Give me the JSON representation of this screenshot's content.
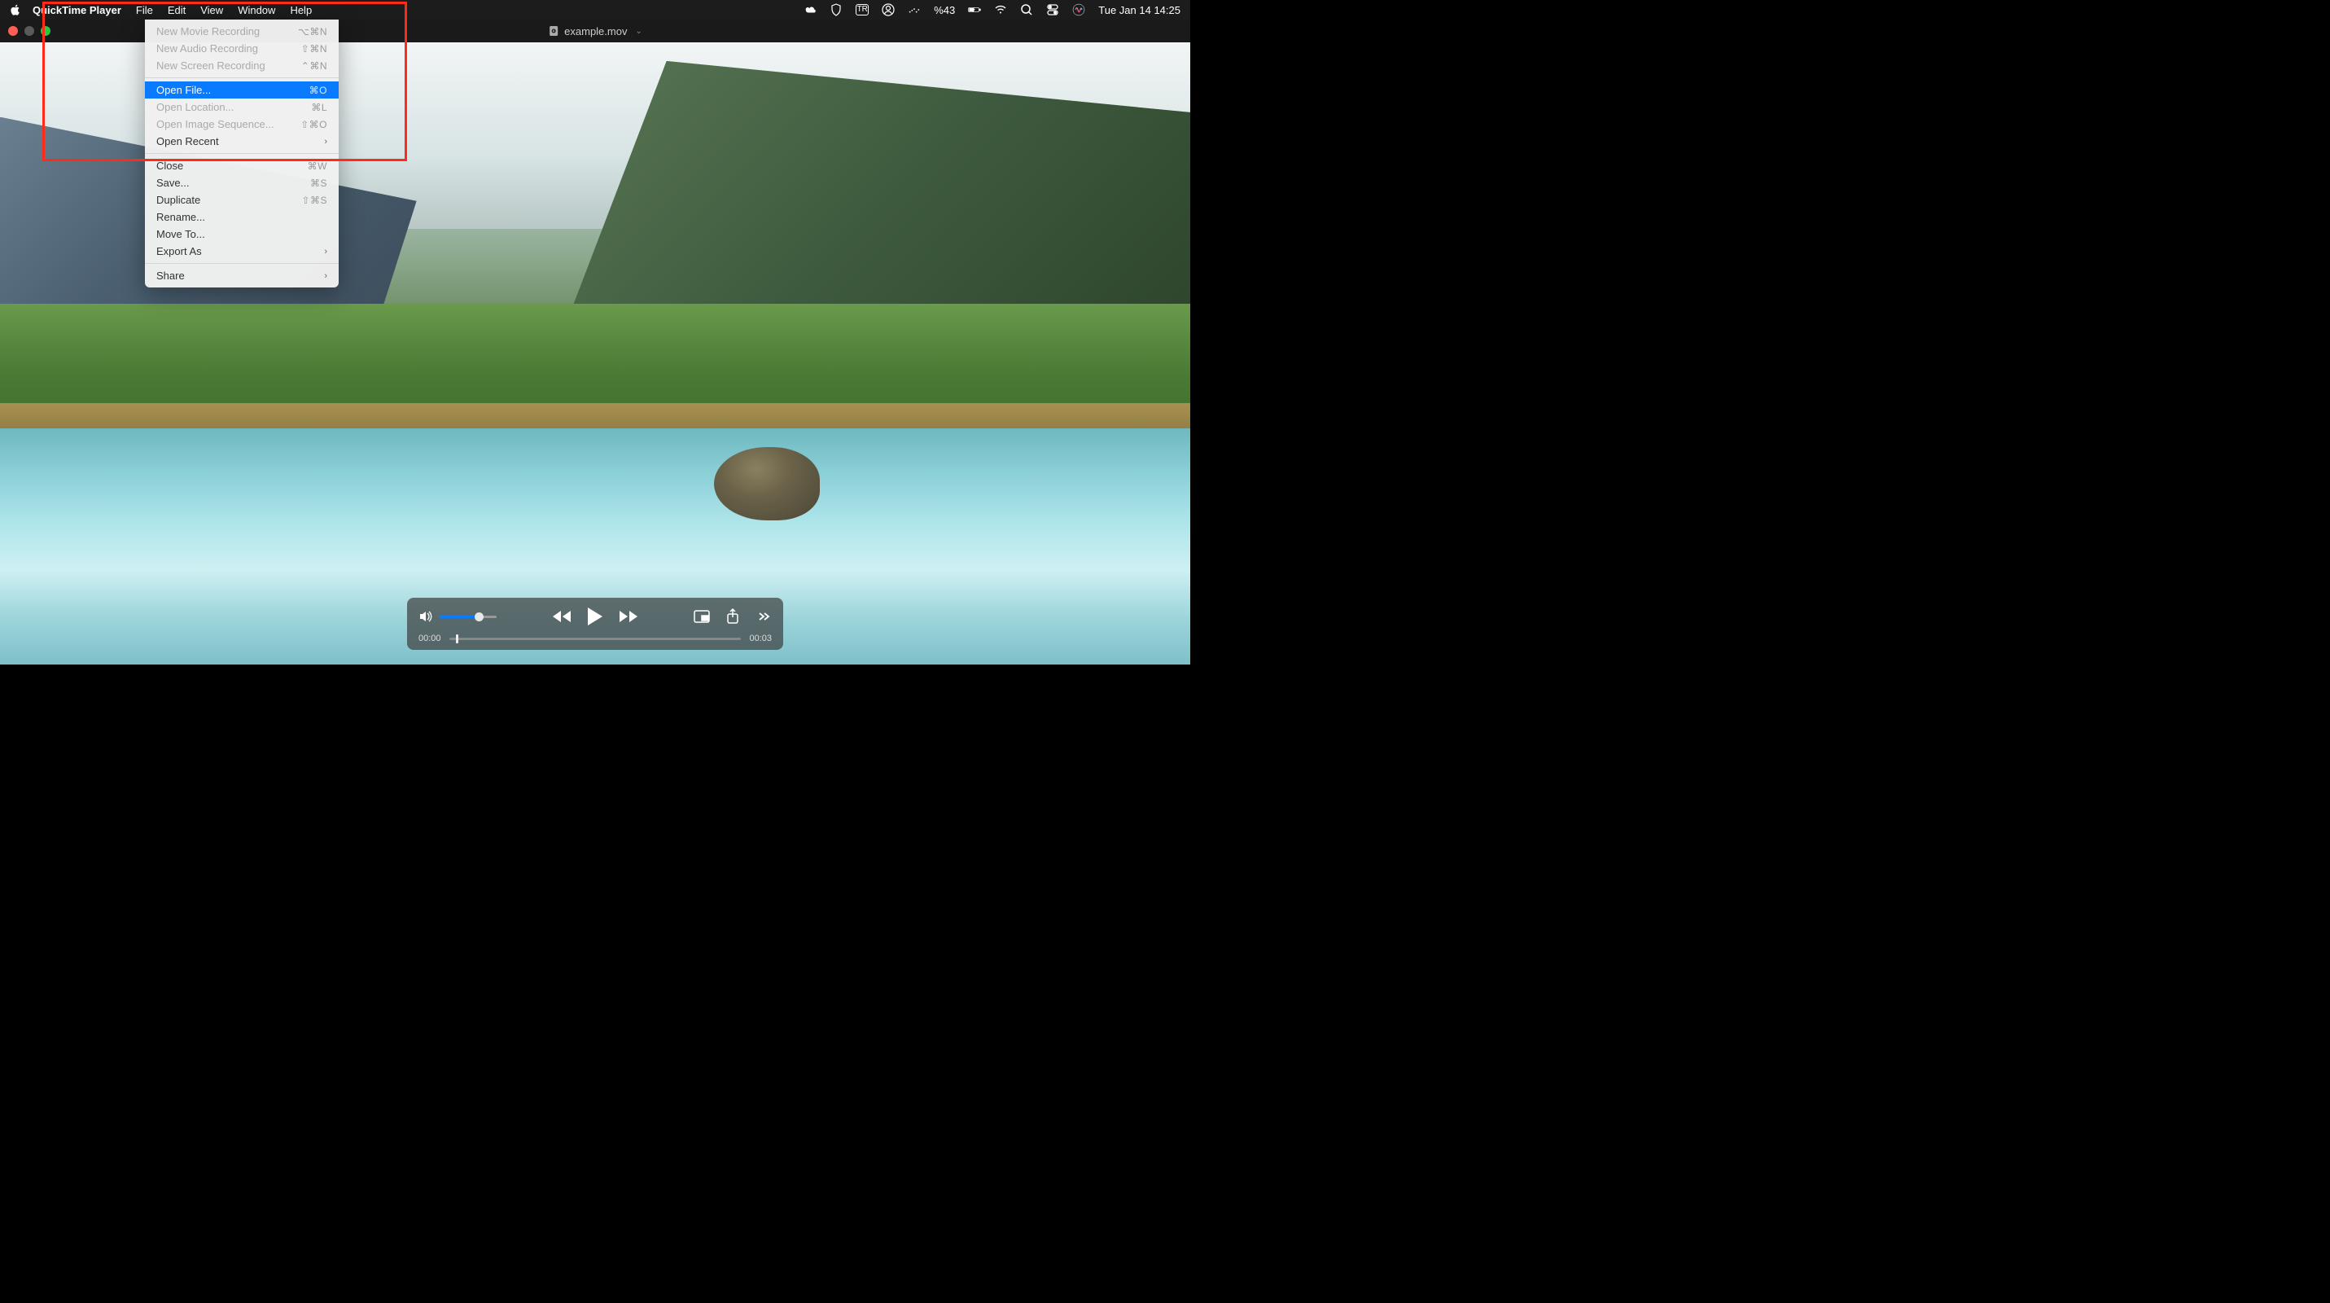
{
  "menubar": {
    "app_name": "QuickTime Player",
    "items": [
      "File",
      "Edit",
      "View",
      "Window",
      "Help"
    ],
    "status": {
      "battery": "%43",
      "datetime": "Tue Jan 14  14:25",
      "input": "TR"
    }
  },
  "titlebar": {
    "filename": "example.mov"
  },
  "dropdown": {
    "groups": [
      [
        {
          "label": "New Movie Recording",
          "shortcut": "⌥⌘N",
          "disabled": true
        },
        {
          "label": "New Audio Recording",
          "shortcut": "⇧⌘N",
          "disabled": true
        },
        {
          "label": "New Screen Recording",
          "shortcut": "⌃⌘N",
          "disabled": true
        }
      ],
      [
        {
          "label": "Open File...",
          "shortcut": "⌘O",
          "highlighted": true
        },
        {
          "label": "Open Location...",
          "shortcut": "⌘L",
          "disabled": true
        },
        {
          "label": "Open Image Sequence...",
          "shortcut": "⇧⌘O",
          "disabled": true
        },
        {
          "label": "Open Recent",
          "submenu": true
        }
      ],
      [
        {
          "label": "Close",
          "shortcut": "⌘W"
        },
        {
          "label": "Save...",
          "shortcut": "⌘S"
        },
        {
          "label": "Duplicate",
          "shortcut": "⇧⌘S"
        },
        {
          "label": "Rename..."
        },
        {
          "label": "Move To..."
        },
        {
          "label": "Export As",
          "submenu": true
        }
      ],
      [
        {
          "label": "Share",
          "submenu": true
        }
      ]
    ]
  },
  "playback": {
    "current_time": "00:00",
    "duration": "00:03"
  }
}
